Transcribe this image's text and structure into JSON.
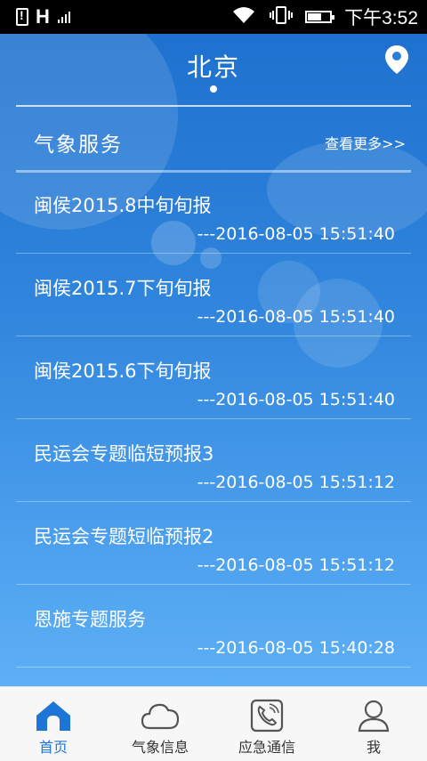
{
  "status_bar": {
    "network": "H",
    "time": "下午3:52",
    "battery_level": 0.6
  },
  "header": {
    "city": "北京",
    "location_icon": "location-pin-icon"
  },
  "service": {
    "title": "气象服务",
    "more": "查看更多>>"
  },
  "items": [
    {
      "title": "闽侯2015.8中旬旬报",
      "time": "---2016-08-05 15:51:40"
    },
    {
      "title": "闽侯2015.7下旬旬报",
      "time": "---2016-08-05 15:51:40"
    },
    {
      "title": "闽侯2015.6下旬旬报",
      "time": "---2016-08-05 15:51:40"
    },
    {
      "title": "民运会专题临短预报3",
      "time": "---2016-08-05 15:51:12"
    },
    {
      "title": "民运会专题短临预报2",
      "time": "---2016-08-05 15:51:12"
    },
    {
      "title": "恩施专题服务",
      "time": "---2016-08-05 15:40:28"
    }
  ],
  "tabs": [
    {
      "label": "首页",
      "icon": "home-icon",
      "active": true
    },
    {
      "label": "气象信息",
      "icon": "cloud-icon",
      "active": false
    },
    {
      "label": "应急通信",
      "icon": "phone-icon",
      "active": false
    },
    {
      "label": "我",
      "icon": "user-icon",
      "active": false
    }
  ],
  "colors": {
    "accent": "#1d76d6",
    "background_top": "#1f71cf",
    "background_bottom": "#5db0f5",
    "tab_inactive": "#555555"
  }
}
